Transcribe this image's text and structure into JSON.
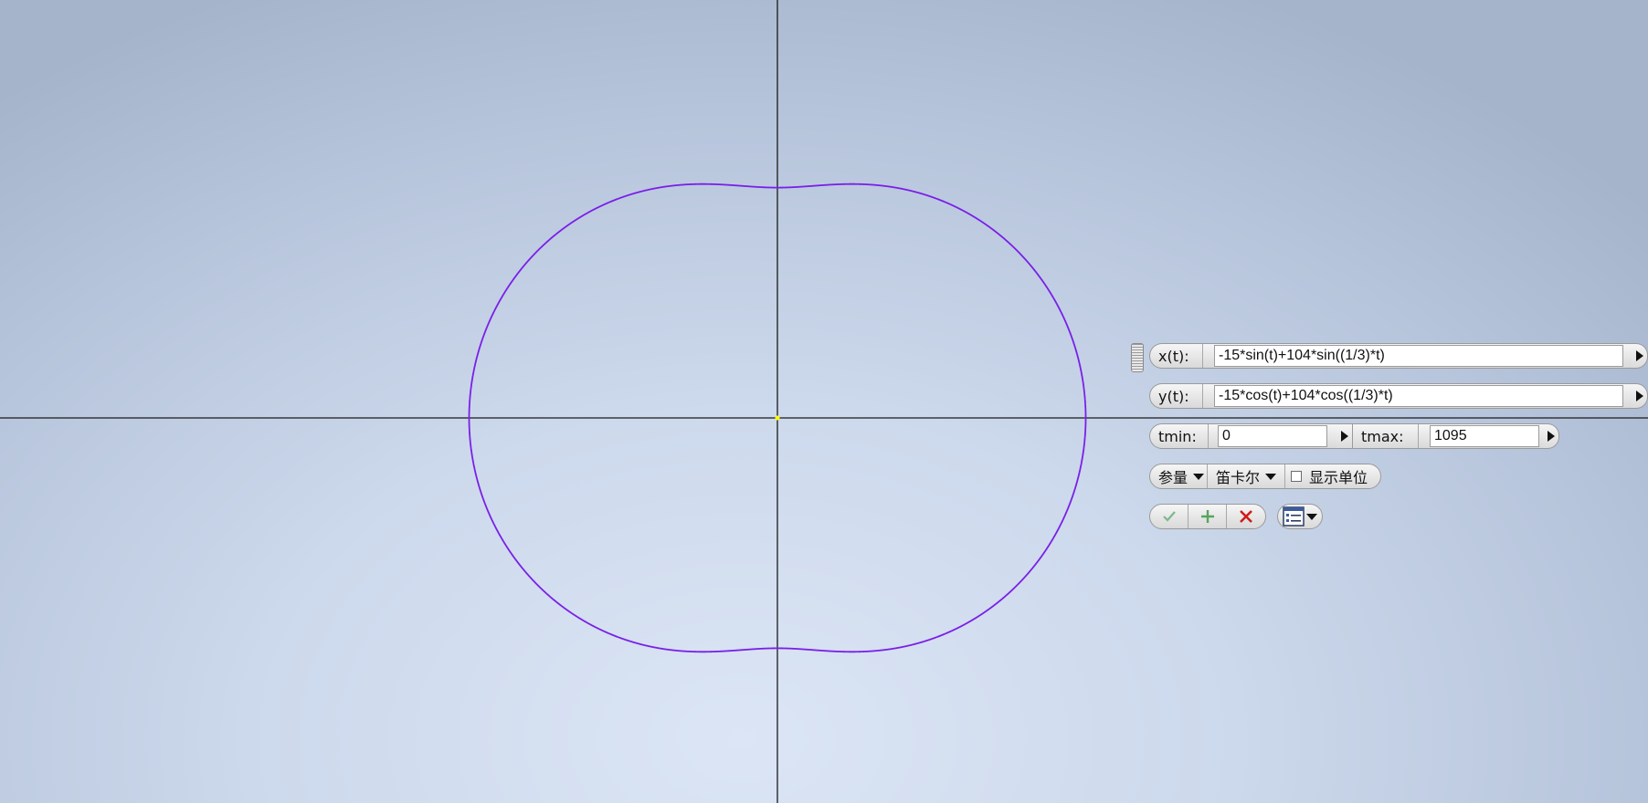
{
  "window": {
    "title": ""
  },
  "colors": {
    "curve": "#7a1fe8",
    "axes": "#1a1a1a",
    "origin": "#ffff00"
  },
  "chart_data": {
    "type": "line",
    "x_expression": "-15*sin(t)+104*sin((1/3)*t)",
    "y_expression": "-15*cos(t)+104*cos((1/3)*t)",
    "tmin": 0,
    "tmax": 1095
  },
  "equation_panel": {
    "x_label": "x(t):",
    "x_value": "-15*sin(t)+104*sin((1/3)*t)",
    "y_label": "y(t):",
    "y_value": "-15*cos(t)+104*cos((1/3)*t)",
    "tmin_label": "tmin:",
    "tmin_value": "0",
    "tmax_label": "tmax:",
    "tmax_value": "1095",
    "mode_label": "参量",
    "coord_label": "笛卡尔",
    "show_units_label": "显示单位",
    "show_units_checked": false,
    "icons": {
      "accept": "checkmark-icon",
      "add": "plus-icon",
      "cancel": "close-icon",
      "options": "dialog-options-icon"
    }
  }
}
